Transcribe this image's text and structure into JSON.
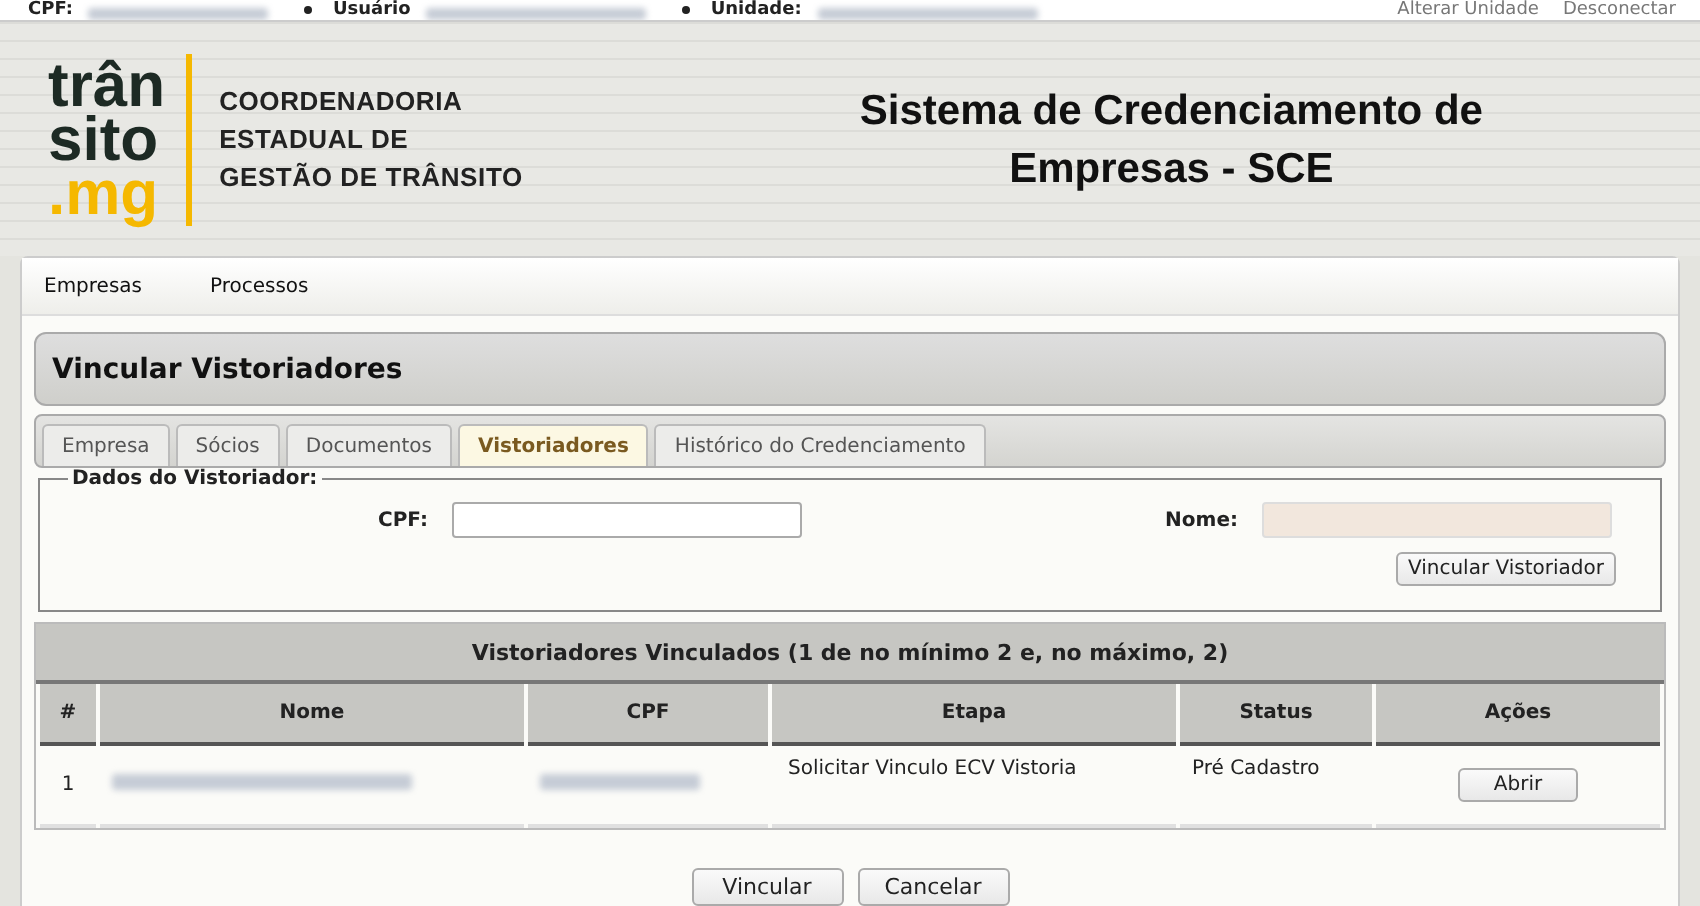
{
  "top_bar": {
    "fields": [
      {
        "label": "CPF:"
      },
      {
        "label": "Usuário"
      },
      {
        "label": "Unidade:"
      }
    ],
    "links": [
      "Alterar Unidade",
      "Desconectar"
    ]
  },
  "header": {
    "logo_lines": [
      "trân",
      "sito",
      ".mg"
    ],
    "org_lines": [
      "COORDENADORIA",
      "ESTADUAL DE",
      "GESTÃO DE TRÂNSITO"
    ],
    "title_lines": [
      "Sistema de Credenciamento de",
      "Empresas - SCE"
    ]
  },
  "menu": [
    "Empresas",
    "Processos"
  ],
  "page_title": "Vincular Vistoriadores",
  "tabs": [
    {
      "label": "Empresa",
      "selected": false
    },
    {
      "label": "Sócios",
      "selected": false
    },
    {
      "label": "Documentos",
      "selected": false
    },
    {
      "label": "Vistoriadores",
      "selected": true
    },
    {
      "label": "Histórico do Credenciamento",
      "selected": false
    }
  ],
  "form": {
    "legend": "Dados do Vistoriador:",
    "cpf_label": "CPF:",
    "nome_label": "Nome:",
    "nome_disabled": true,
    "button": "Vincular Vistoriador"
  },
  "table": {
    "title": "Vistoriadores Vinculados (1 de no mínimo 2 e, no máximo, 2)",
    "columns": [
      "#",
      "Nome",
      "CPF",
      "Etapa",
      "Status",
      "Ações"
    ],
    "rows": [
      {
        "index": "1",
        "etapa": "Solicitar Vinculo ECV Vistoria",
        "status": "Pré Cadastro",
        "action": "Abrir"
      }
    ]
  },
  "buttons": [
    "Vincular",
    "Cancelar"
  ]
}
